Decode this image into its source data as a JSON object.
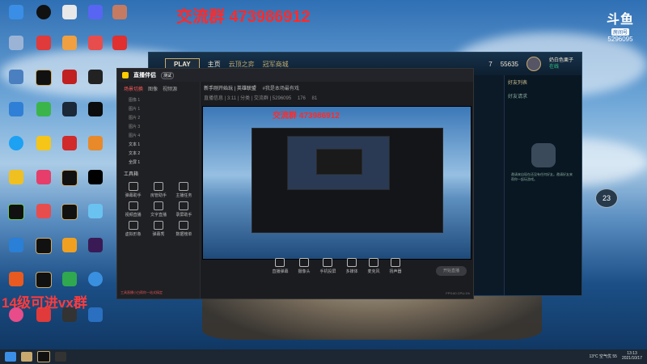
{
  "overlay": {
    "group_top": "交流群 473986912",
    "group_preview": "交流群 473986912",
    "bottom_left": "14级可进vx群"
  },
  "douyu": {
    "logo": "斗鱼",
    "tag": "房间号",
    "room": "5296095"
  },
  "game": {
    "play": "PLAY",
    "nav1": "主页",
    "nav2": "云顶之弈",
    "nav3": "冠军商城",
    "currency": "55635",
    "level": "7",
    "username": "奶白色栗子",
    "status": "在线",
    "friends_header": "好友列表",
    "friend_requests": "好友请求",
    "empty_text": "邀请来自现在还没有任何好友。邀请好友来帮你一起玩游戏。",
    "badge": "23"
  },
  "app": {
    "title": "直播伴侣",
    "version": "测试",
    "scene_tabs": [
      "场景切换",
      "图像",
      "视频源"
    ],
    "layers": [
      "图像 1",
      "图片 1",
      "图片 2",
      "图片 3",
      "图片 4",
      "文本 1",
      "文本 2",
      "全屏 1"
    ],
    "tools_title": "工具箱",
    "tools": [
      "弹幕助手",
      "房管助手",
      "主播任务",
      "视频直播",
      "文字直播",
      "录屏助手",
      "虚拟形象",
      "弹幕秀",
      "数据榜单"
    ],
    "notice": "工具直播小白帮你一站式搞定",
    "info_title": "新手刚开始玩 | 英雄联盟",
    "info_tag": "#我是本场最有戏",
    "info_sub": "直播信息 | 3:11 | 分类 | 交流群 | 5296095",
    "viewers": "176",
    "likes": "81",
    "bottom_buttons": [
      "直播弹幕",
      "摄像头",
      "手机投屏",
      "多媒体",
      "麦克风",
      "扬声器"
    ],
    "start_live": "开始直播",
    "fps": "FPS:60 CPU:1%"
  },
  "taskbar": {
    "weather": "13°C 空气优 55",
    "time": "13:13",
    "date": "2021/10/17"
  }
}
